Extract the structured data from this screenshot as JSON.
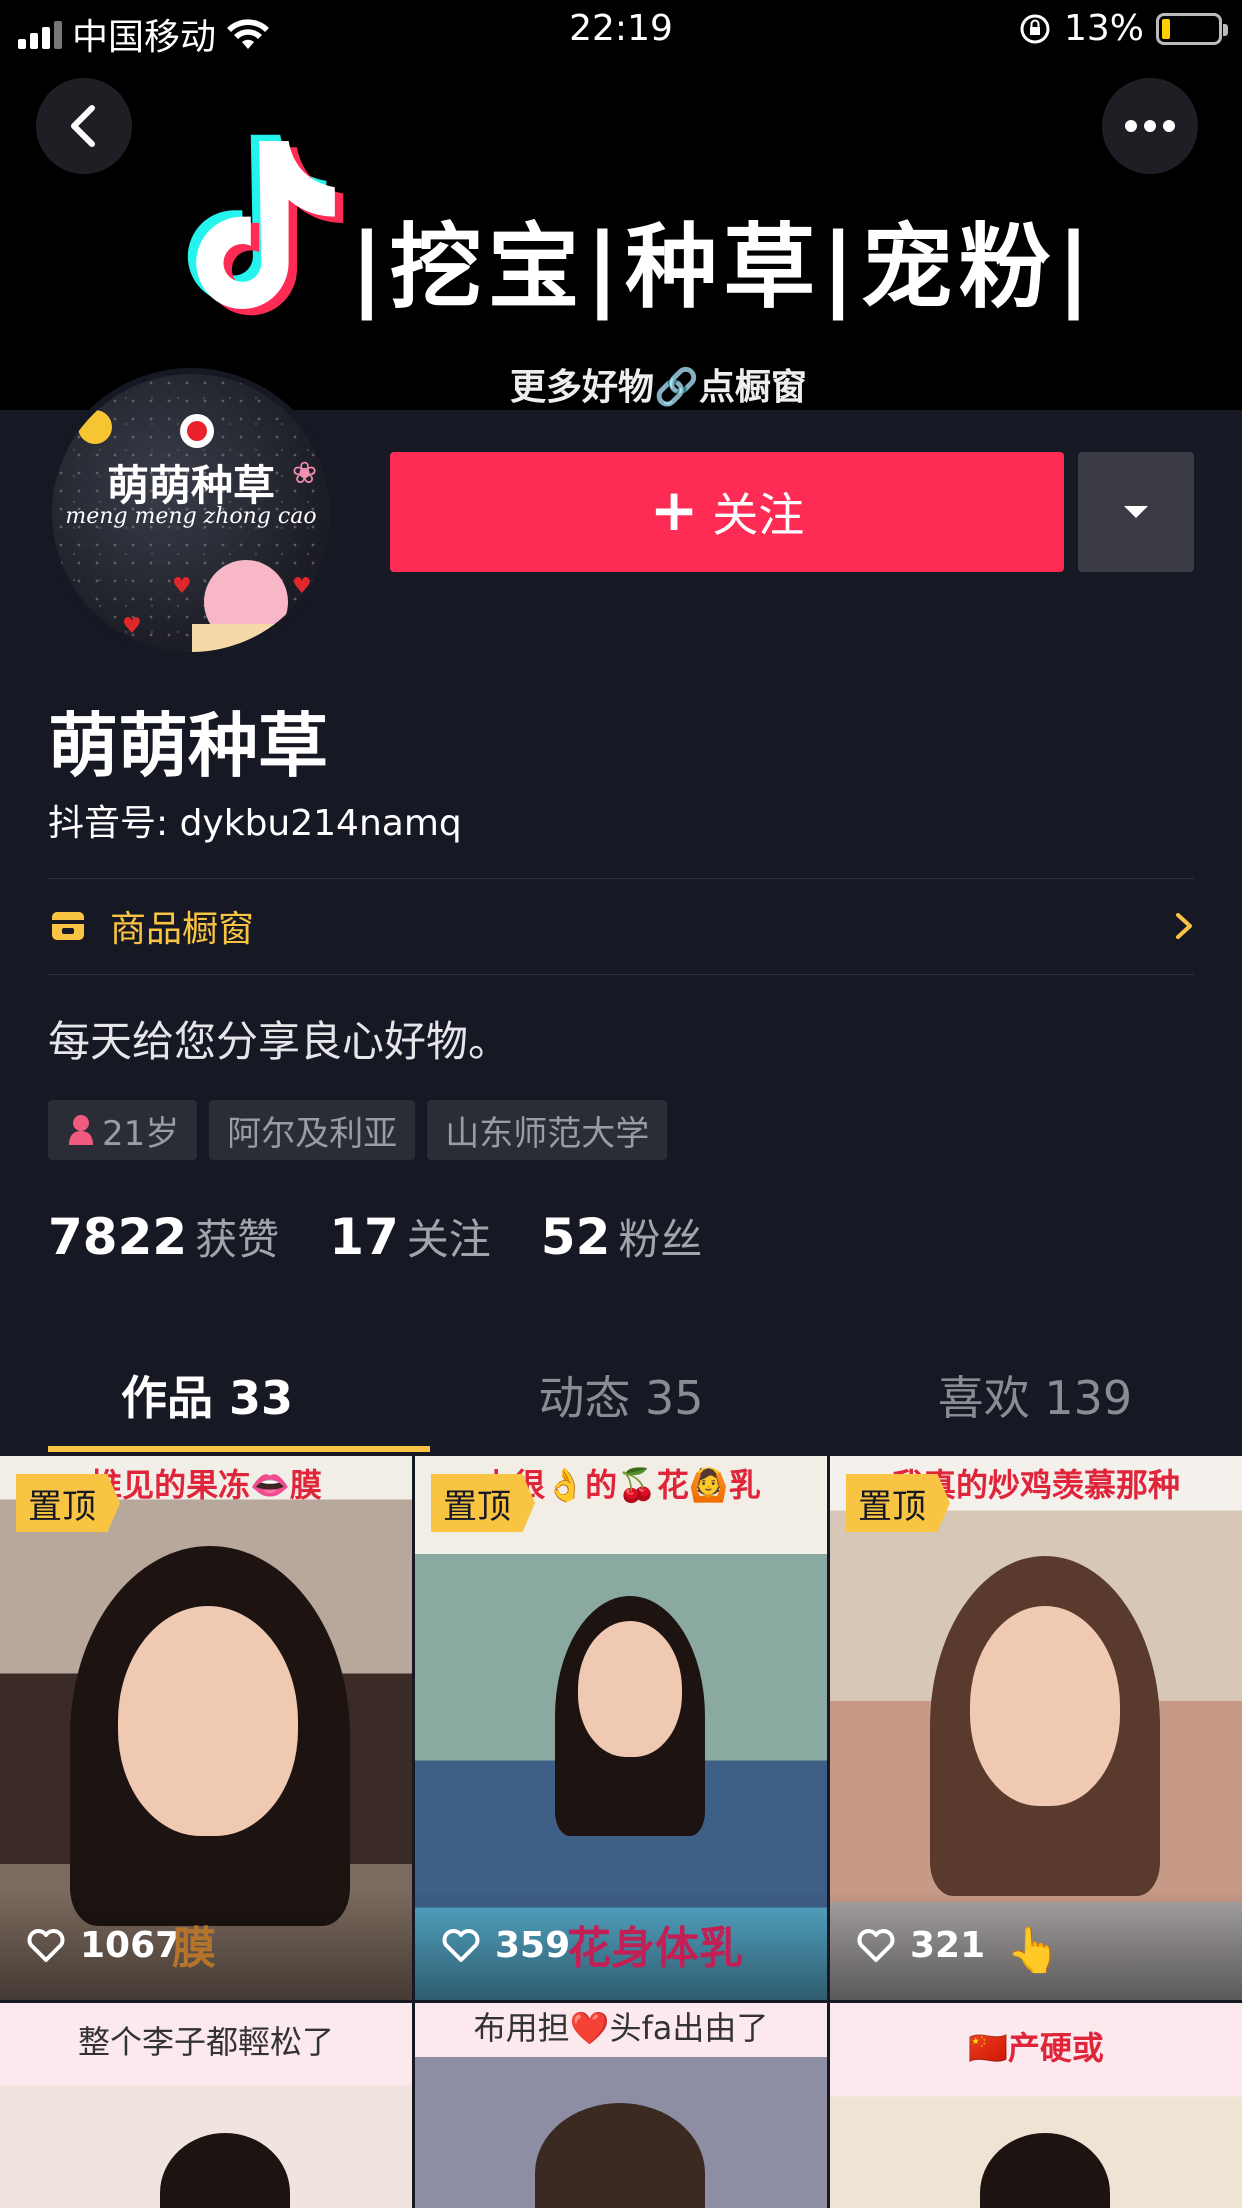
{
  "status_bar": {
    "carrier": "中国移动",
    "time": "22:19",
    "battery": "13%"
  },
  "banner": {
    "slogan": "|挖宝|种草|宠粉|",
    "sub": "更多好物🔗点橱窗"
  },
  "avatar": {
    "title": "萌萌种草",
    "subtitle": "meng meng zhong cao"
  },
  "actions": {
    "follow_label": "关注"
  },
  "profile": {
    "name": "萌萌种草",
    "douyin_id": "抖音号: dykbu214namq",
    "shop_label": "商品橱窗",
    "bio": "每天给您分享良心好物。",
    "tags": {
      "age": "21岁",
      "location": "阿尔及利亚",
      "school": "山东师范大学"
    }
  },
  "stats": [
    {
      "value": "7822",
      "label": "获赞"
    },
    {
      "value": "17",
      "label": "关注"
    },
    {
      "value": "52",
      "label": "粉丝"
    }
  ],
  "tabs": [
    {
      "label": "作品 33"
    },
    {
      "label": "动态 35"
    },
    {
      "label": "喜欢 139"
    }
  ],
  "videos": [
    {
      "caption": "推见的果冻👄膜",
      "pinned": "置顶",
      "likes": "1067",
      "tagline": "膜"
    },
    {
      "caption": "上很👌的🍒花🙆乳",
      "pinned": "置顶",
      "likes": "359",
      "tagline": "花身体乳"
    },
    {
      "caption": "我真的炒鸡羡慕那种",
      "pinned": "置顶",
      "likes": "321",
      "tagline": "👆"
    },
    {
      "caption": "整个李子都輕松了"
    },
    {
      "caption": "布用担❤️头fa出由了"
    },
    {
      "caption": "🇨🇳产硬或"
    }
  ],
  "colors": {
    "accent": "#fe2c55",
    "highlight": "#f9c441",
    "background": "#161823"
  }
}
